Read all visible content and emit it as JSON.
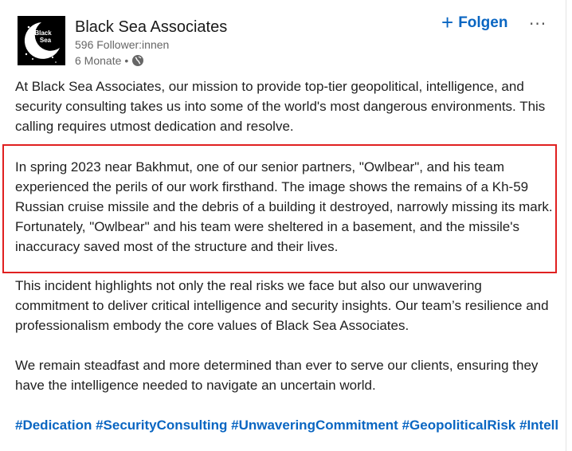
{
  "post": {
    "author": {
      "name": "Black Sea Associates",
      "followers": "596 Follower:innen",
      "time": "6 Monate",
      "separator": "•",
      "logo_text_line1": "Black",
      "logo_text_line2": "Sea",
      "visibility_icon": "globe-icon"
    },
    "follow_label": "Folgen",
    "follow_icon": "+",
    "more_icon": "···",
    "paragraphs": [
      "At Black Sea Associates, our mission to provide top-tier geopolitical, intelligence, and security consulting takes us into some of the world's most dangerous environments. This calling requires utmost dedication and resolve.",
      "In spring 2023 near Bakhmut, one of our senior partners, \"Owlbear\", and his team experienced the perils of our work firsthand. The image shows the remains of a Kh-59 Russian cruise missile and the debris of a building it destroyed, narrowly missing its mark. Fortunately, \"Owlbear\" and his team were sheltered in a basement, and the missile's inaccuracy saved most of the structure and their lives.",
      "This incident highlights not only the real risks we face but also our unwavering commitment to deliver critical intelligence and security insights. Our team’s resilience and professionalism embody the core values of Black Sea Associates.",
      "We remain steadfast and more determined than ever to serve our clients, ensuring they have the intelligence needed to navigate an uncertain world."
    ],
    "hashtags": [
      "#Dedication",
      "#SecurityConsulting",
      "#UnwaveringCommitment",
      "#GeopoliticalRisk",
      "#Intell"
    ]
  },
  "colors": {
    "link_blue": "#0a66c2",
    "highlight_red": "#e02020",
    "secondary_text": "#666666"
  }
}
